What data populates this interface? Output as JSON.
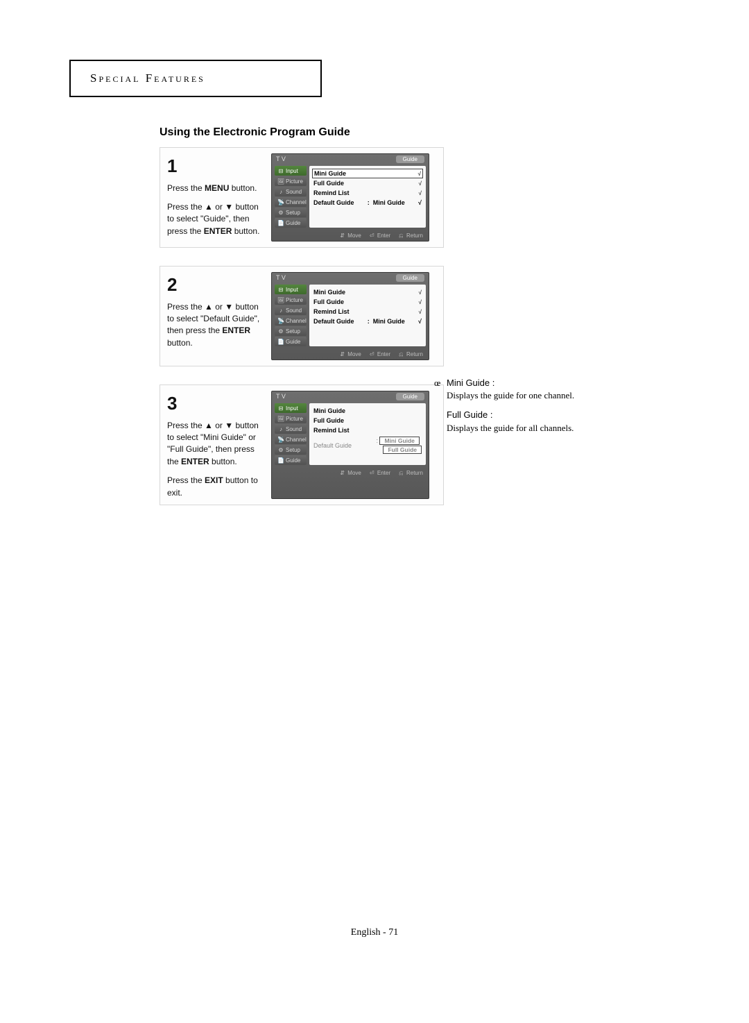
{
  "header": "Special Features",
  "section_title": "Using the Electronic Program Guide",
  "steps": {
    "s1": {
      "num": "1",
      "line1a": "Press the ",
      "line1b": "MENU",
      "line1c": " button.",
      "line2a": "Press the ▲ or ▼ button to select \"Guide\", then press the ",
      "line2b": "ENTER",
      "line2c": " button."
    },
    "s2": {
      "num": "2",
      "line1a": "Press the ▲ or ▼ button to select \"Default Guide\", then press the ",
      "line1b": "ENTER",
      "line1c": " button."
    },
    "s3": {
      "num": "3",
      "line1a": "Press the ▲ or ▼ button to select \"Mini Guide\" or \"Full Guide\", then press the ",
      "line1b": "ENTER",
      "line1c": " button.",
      "line2a": "Press the ",
      "line2b": "EXIT",
      "line2c": " button to exit."
    }
  },
  "tv": {
    "top_left": "T V",
    "top_right": "Guide",
    "nav": [
      "Input",
      "Picture",
      "Sound",
      "Channel",
      "Setup",
      "Guide"
    ],
    "menu": {
      "mini": "Mini Guide",
      "full": "Full Guide",
      "remind": "Remind List",
      "default": "Default Guide",
      "default_sep": ":",
      "default_val": "Mini Guide",
      "arrow": "√"
    },
    "dropdown": {
      "opt1": "Mini Guide",
      "opt2": "Full Guide"
    },
    "footer": {
      "move": "Move",
      "enter": "Enter",
      "ret": "Return"
    }
  },
  "side": {
    "sym": "œ",
    "h1": "Mini Guide :",
    "d1": "Displays the guide for one channel.",
    "h2": "Full Guide :",
    "d2": "Displays the guide for all channels."
  },
  "footer": "English - 71"
}
